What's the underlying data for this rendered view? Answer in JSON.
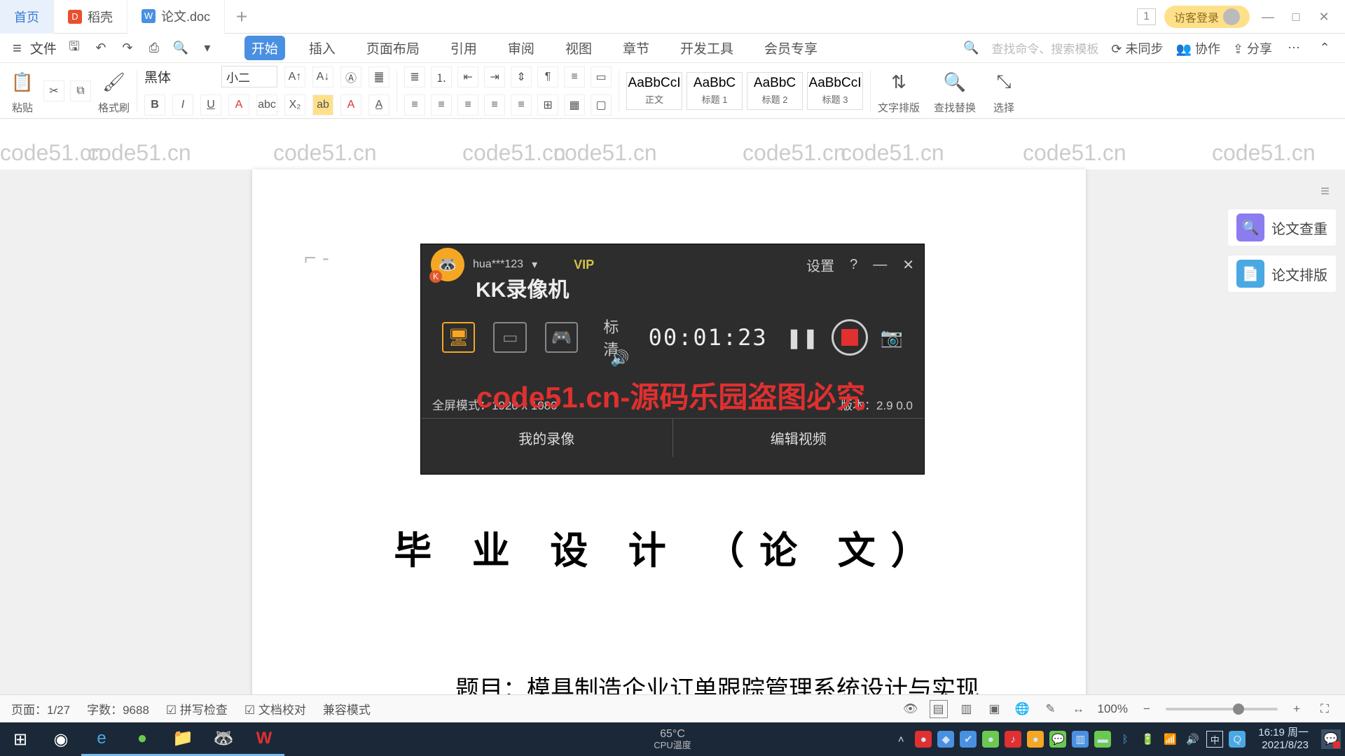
{
  "tabs": {
    "home": "首页",
    "t1": "稻壳",
    "t2": "论文.doc",
    "plus": "+"
  },
  "title_right": {
    "num": "1",
    "login": "访客登录",
    "min": "—",
    "max": "□",
    "close": "✕"
  },
  "menubar": {
    "file": "文件",
    "items": [
      "开始",
      "插入",
      "页面布局",
      "引用",
      "审阅",
      "视图",
      "章节",
      "开发工具",
      "会员专享"
    ],
    "search": "查找命令、搜索模板",
    "right": [
      "未同步",
      "协作",
      "分享"
    ]
  },
  "ribbon": {
    "paste": "粘贴",
    "brush": "格式刷",
    "font": "黑体",
    "size": "小二",
    "styles": [
      {
        "prev": "AaBbCcI",
        "lab": "正文"
      },
      {
        "prev": "AaBbC",
        "lab": "标题 1"
      },
      {
        "prev": "AaBbC",
        "lab": "标题 2"
      },
      {
        "prev": "AaBbCcI",
        "lab": "标题 3"
      }
    ],
    "tools": [
      "文字排版",
      "查找替换",
      "选择"
    ]
  },
  "doc": {
    "title": "毕 业 设 计 （论 文）",
    "subject_label": "题目：",
    "subject_value": "模具制造企业订单跟踪管理系统设计与实现",
    "mark": "⌐ -"
  },
  "right_panel": {
    "a": "论文查重",
    "b": "论文排版"
  },
  "kk": {
    "title": "KK录像机",
    "user": "hua***123",
    "drop": "▾",
    "vip": "VIP",
    "settings": "设置",
    "help": "?",
    "min": "—",
    "close": "✕",
    "quality": "标清",
    "time": "00:01:23",
    "mode_info": "全屏模式：1920 x 1080",
    "version": "版本：2.9 0.0",
    "my_rec": "我的录像",
    "edit": "编辑视频"
  },
  "statusbar": {
    "page": "页面：1/27",
    "words": "字数：9688",
    "spell": "拼写检查",
    "proof": "文档校对",
    "compat": "兼容模式",
    "zoom": "100%"
  },
  "taskbar": {
    "cpu_label": "CPU温度",
    "cpu_temp": "65°C",
    "time": "16:19 周一",
    "date": "2021/8/23",
    "ime": "中"
  },
  "watermark": "code51.cn",
  "watermark_red": "code51.cn-源码乐园盗图必究"
}
